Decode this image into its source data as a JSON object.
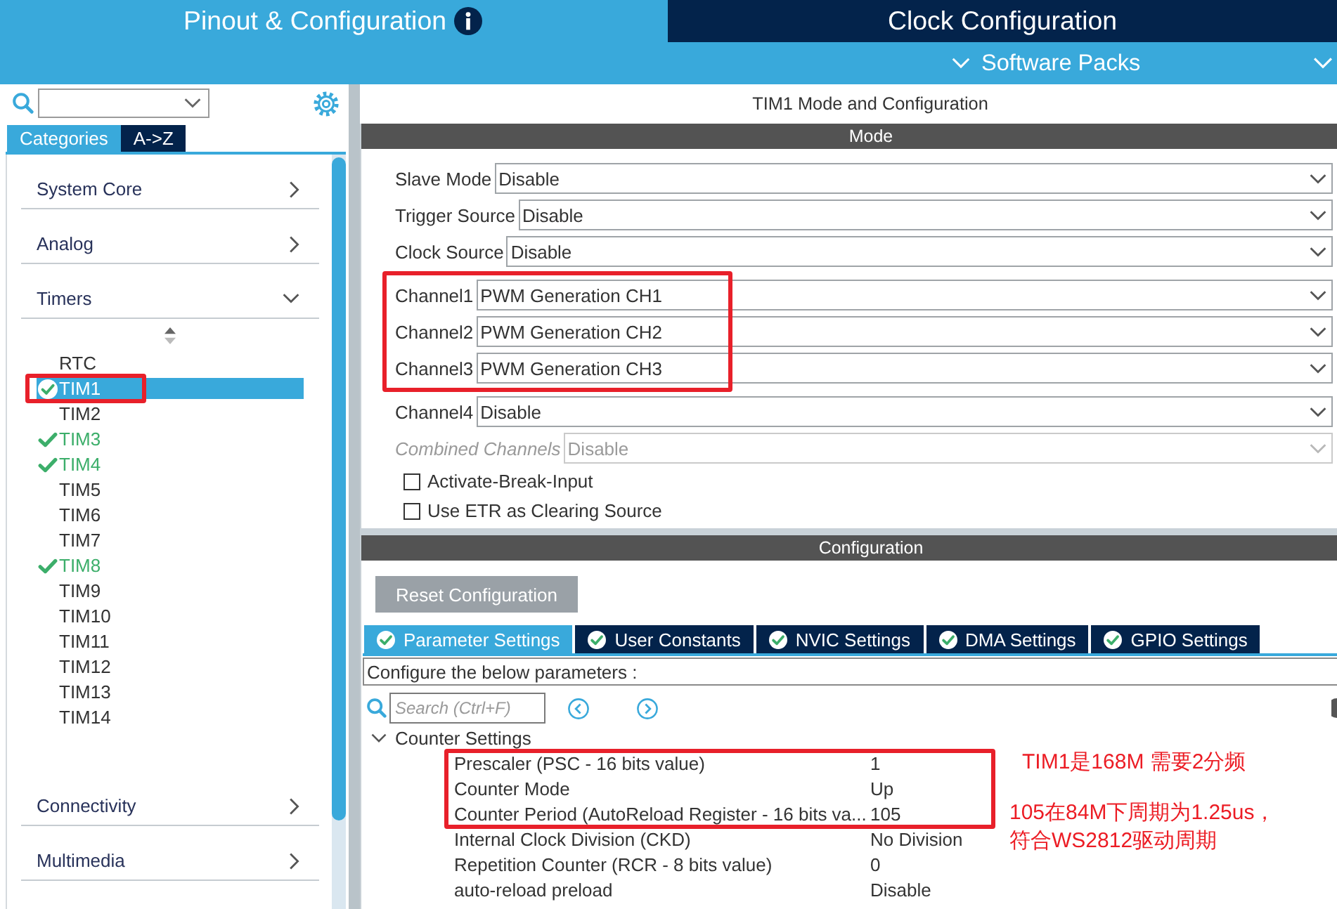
{
  "tabs": [
    {
      "label": "Pinout & Configuration",
      "selected": true,
      "info": true
    },
    {
      "label": "Clock Configuration",
      "selected": false,
      "info": false
    }
  ],
  "software_packs": {
    "label": "Software Packs"
  },
  "sidebar": {
    "view_tabs": [
      {
        "label": "Categories",
        "selected": true
      },
      {
        "label": "A->Z",
        "selected": false
      }
    ],
    "categories": [
      {
        "label": "System Core",
        "expanded": false
      },
      {
        "label": "Analog",
        "expanded": false
      },
      {
        "label": "Timers",
        "expanded": true,
        "children": [
          {
            "label": "RTC",
            "selected": false,
            "configured": false,
            "highlighted": false
          },
          {
            "label": "TIM1",
            "selected": true,
            "configured": true,
            "highlighted": true
          },
          {
            "label": "TIM2",
            "selected": false,
            "configured": false,
            "highlighted": false
          },
          {
            "label": "TIM3",
            "selected": false,
            "configured": true,
            "highlighted": false
          },
          {
            "label": "TIM4",
            "selected": false,
            "configured": true,
            "highlighted": false
          },
          {
            "label": "TIM5",
            "selected": false,
            "configured": false,
            "highlighted": false
          },
          {
            "label": "TIM6",
            "selected": false,
            "configured": false,
            "highlighted": false
          },
          {
            "label": "TIM7",
            "selected": false,
            "configured": false,
            "highlighted": false
          },
          {
            "label": "TIM8",
            "selected": false,
            "configured": true,
            "highlighted": false
          },
          {
            "label": "TIM9",
            "selected": false,
            "configured": false,
            "highlighted": false
          },
          {
            "label": "TIM10",
            "selected": false,
            "configured": false,
            "highlighted": false
          },
          {
            "label": "TIM11",
            "selected": false,
            "configured": false,
            "highlighted": false
          },
          {
            "label": "TIM12",
            "selected": false,
            "configured": false,
            "highlighted": false
          },
          {
            "label": "TIM13",
            "selected": false,
            "configured": false,
            "highlighted": false
          },
          {
            "label": "TIM14",
            "selected": false,
            "configured": false,
            "highlighted": false
          }
        ]
      },
      {
        "label": "Connectivity",
        "expanded": false
      },
      {
        "label": "Multimedia",
        "expanded": false
      }
    ]
  },
  "panel": {
    "title": "TIM1 Mode and Configuration",
    "mode": {
      "heading": "Mode",
      "fields": [
        {
          "kind": "select",
          "label": "Slave Mode",
          "value": "Disable",
          "disabled": false,
          "highlighted": false
        },
        {
          "kind": "select",
          "label": "Trigger Source",
          "value": "Disable",
          "disabled": false,
          "highlighted": false
        },
        {
          "kind": "select",
          "label": "Clock Source",
          "value": "Disable",
          "disabled": false,
          "highlighted": false
        },
        {
          "kind": "select",
          "label": "Channel1",
          "value": "PWM Generation CH1",
          "disabled": false,
          "highlighted": true
        },
        {
          "kind": "select",
          "label": "Channel2",
          "value": "PWM Generation CH2",
          "disabled": false,
          "highlighted": true
        },
        {
          "kind": "select",
          "label": "Channel3",
          "value": "PWM Generation CH3",
          "disabled": false,
          "highlighted": true
        },
        {
          "kind": "select",
          "label": "Channel4",
          "value": "Disable",
          "disabled": false,
          "highlighted": false
        },
        {
          "kind": "select",
          "label": "Combined Channels",
          "value": "Disable",
          "disabled": true,
          "highlighted": false
        },
        {
          "kind": "checkbox",
          "label": "Activate-Break-Input",
          "checked": false,
          "disabled": false,
          "highlighted": false
        },
        {
          "kind": "checkbox",
          "label": "Use ETR as Clearing Source",
          "checked": false,
          "disabled": false,
          "highlighted": false
        }
      ]
    },
    "configuration": {
      "heading": "Configuration",
      "reset_button": "Reset Configuration",
      "tabs": [
        {
          "label": "Parameter Settings",
          "selected": true
        },
        {
          "label": "User Constants",
          "selected": false
        },
        {
          "label": "NVIC Settings",
          "selected": false
        },
        {
          "label": "DMA Settings",
          "selected": false
        },
        {
          "label": "GPIO Settings",
          "selected": false
        }
      ],
      "hint": "Configure the below parameters :",
      "search": {
        "placeholder": "Search (Ctrl+F)"
      },
      "groups": [
        {
          "label": "Counter Settings",
          "expanded": true,
          "params": [
            {
              "name": "Prescaler (PSC - 16 bits value)",
              "value": "1",
              "highlighted": true
            },
            {
              "name": "Counter Mode",
              "value": "Up",
              "highlighted": true
            },
            {
              "name": "Counter Period (AutoReload Register - 16 bits va...",
              "value": "105",
              "highlighted": true
            },
            {
              "name": "Internal Clock Division (CKD)",
              "value": "No Division",
              "highlighted": false
            },
            {
              "name": "Repetition Counter (RCR - 8 bits value)",
              "value": "0",
              "highlighted": false
            },
            {
              "name": "auto-reload preload",
              "value": "Disable",
              "highlighted": false
            }
          ]
        }
      ]
    }
  },
  "annotations": [
    {
      "text": "TIM1是168M 需要2分频"
    },
    {
      "text": "105在84M下周期为1.25us，符合WS2812驱动周期"
    }
  ]
}
